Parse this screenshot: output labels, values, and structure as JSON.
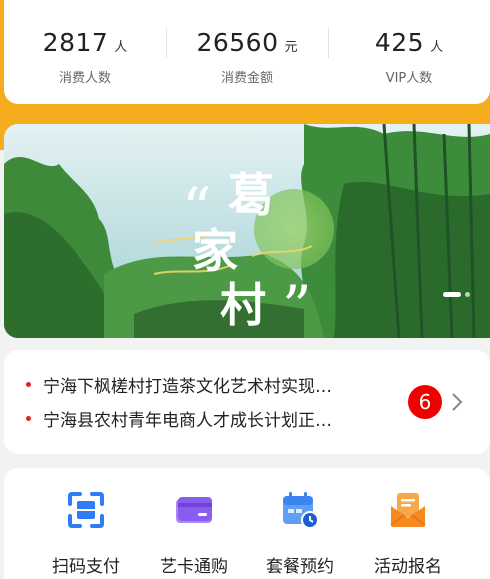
{
  "stats": [
    {
      "value": "2817",
      "unit": "人",
      "label": "消费人数"
    },
    {
      "value": "26560",
      "unit": "元",
      "label": "消费金额"
    },
    {
      "value": "425",
      "unit": "人",
      "label": "VIP人数"
    }
  ],
  "banner": {
    "title_chars": [
      "葛",
      "家",
      "村"
    ],
    "quote_open": "“",
    "quote_close": "”"
  },
  "news": {
    "items": [
      "宁海下枫槎村打造茶文化艺术村实现…",
      "宁海县农村青年电商人才成长计划正…"
    ],
    "badge_count": "6"
  },
  "services": [
    {
      "label": "扫码支付",
      "icon": "scan-icon",
      "color": "#2f7cf6"
    },
    {
      "label": "艺卡通购",
      "icon": "card-icon",
      "color": "#8a5cf0"
    },
    {
      "label": "套餐预约",
      "icon": "calendar-clock-icon",
      "color": "#3a86f0"
    },
    {
      "label": "活动报名",
      "icon": "envelope-icon",
      "color": "#f5891f"
    }
  ],
  "colors": {
    "accent": "#f5ac1d",
    "badge": "#f00000",
    "bullet": "#e1251b"
  }
}
